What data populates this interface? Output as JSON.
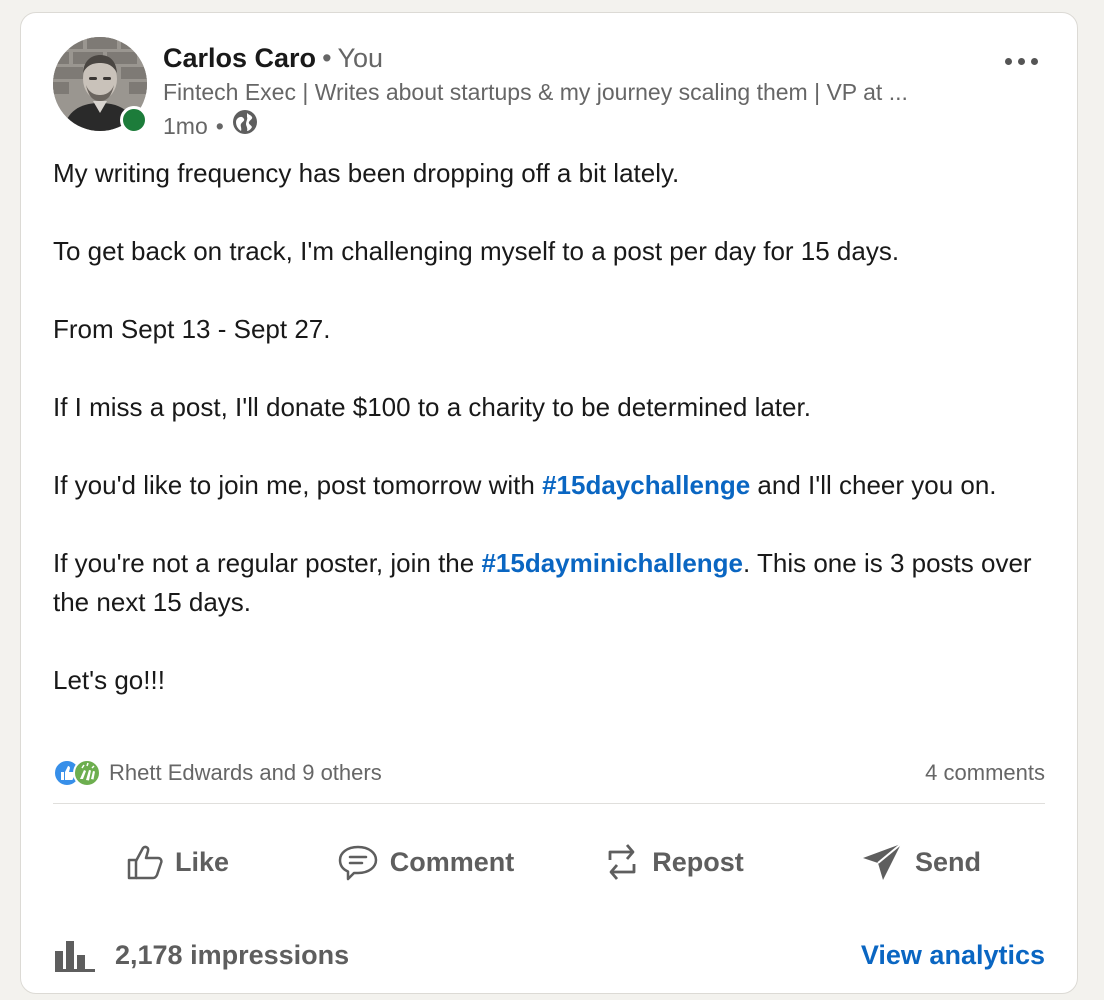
{
  "author": {
    "name": "Carlos Caro",
    "separator": "•",
    "relation": "You",
    "headline": "Fintech Exec | Writes about startups & my journey scaling them | VP at ...",
    "time": "1mo",
    "meta_separator": "•",
    "visibility_icon": "globe-icon",
    "presence_color": "#1c7c3a"
  },
  "post": {
    "paragraphs": [
      {
        "before": "My writing frequency has been dropping off a bit lately."
      },
      {
        "before": "To get back on track, I'm challenging myself to a post per day for 15 days."
      },
      {
        "before": "From Sept 13 - Sept 27."
      },
      {
        "before": "If I miss a post, I'll donate $100 to a charity to be determined later."
      },
      {
        "before": "If you'd like to join me, post tomorrow with ",
        "hashtag": "#15daychallenge",
        "after": " and I'll cheer you on."
      },
      {
        "before": "If you're not a regular poster, join the ",
        "hashtag": "#15dayminichallenge",
        "after": ". This one is 3 posts over the next 15 days."
      },
      {
        "before": "Let's go!!!"
      }
    ]
  },
  "social": {
    "reactions_label": "Rhett Edwards and 9 others",
    "comments_label": "4 comments",
    "reaction_icons": [
      "like-reaction-icon",
      "celebrate-reaction-icon"
    ]
  },
  "actions": {
    "like": "Like",
    "comment": "Comment",
    "repost": "Repost",
    "send": "Send"
  },
  "footer": {
    "impressions": "2,178 impressions",
    "analytics": "View analytics"
  },
  "colors": {
    "link": "#0a66c2",
    "muted": "#666666",
    "text": "#191919"
  }
}
